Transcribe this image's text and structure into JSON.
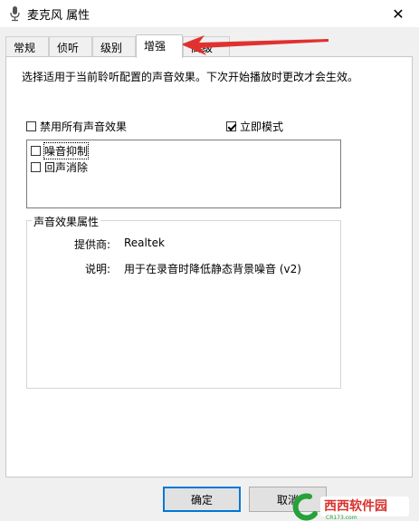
{
  "window": {
    "title": "麦克风 属性",
    "close_glyph": "✕",
    "icon": "microphone-icon"
  },
  "tabs": [
    {
      "label": "常规",
      "active": false
    },
    {
      "label": "侦听",
      "active": false
    },
    {
      "label": "级别",
      "active": false
    },
    {
      "label": "增强",
      "active": true
    },
    {
      "label": "高级",
      "active": false
    }
  ],
  "enhancements": {
    "description": "选择适用于当前聆听配置的声音效果。下次开始播放时更改才会生效。",
    "disable_all": {
      "label": "禁用所有声音效果",
      "checked": false
    },
    "immediate_mode": {
      "label": "立即模式",
      "checked": true
    },
    "effects": [
      {
        "label": "噪音抑制",
        "checked": false,
        "focused": true
      },
      {
        "label": "回声消除",
        "checked": false,
        "focused": false
      }
    ]
  },
  "properties": {
    "title": "声音效果属性",
    "provider_label": "提供商:",
    "provider_value": "Realtek",
    "desc_label": "说明:",
    "desc_value": "用于在录音时降低静态背景噪音 (v2)"
  },
  "buttons": {
    "ok": "确定",
    "cancel": "取消"
  },
  "watermark": {
    "text": "西西软件园",
    "sub": "CR173.com"
  },
  "colors": {
    "accent": "#0078d7",
    "arrow": "#e0312f",
    "watermark_green": "#27a13a",
    "watermark_red": "#d9302a"
  }
}
